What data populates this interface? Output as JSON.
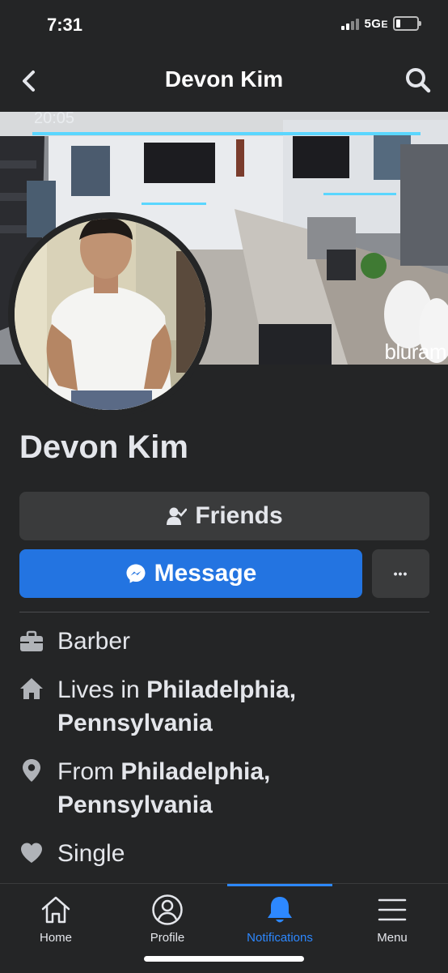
{
  "status_bar": {
    "time": "7:31",
    "network": "5G",
    "network_suffix": "E"
  },
  "header": {
    "title": "Devon Kim",
    "back_icon": "chevron-left-icon",
    "search_icon": "search-icon"
  },
  "cover": {
    "overlay_text": "20:05",
    "watermark": "bluram"
  },
  "profile": {
    "name": "Devon Kim",
    "friends_label": "Friends",
    "message_label": "Message",
    "more_label": "•••"
  },
  "info": {
    "work": "Barber",
    "lives_prefix": "Lives in ",
    "lives_place_line1": "Philadelphia,",
    "lives_place_line2": "Pennsylvania",
    "from_prefix": "From ",
    "from_place_line1": "Philadelphia,",
    "from_place_line2": "Pennsylvania",
    "relationship": "Single"
  },
  "nav": {
    "items": [
      {
        "label": "Home",
        "icon": "home-icon"
      },
      {
        "label": "Profile",
        "icon": "profile-icon"
      },
      {
        "label": "Notifications",
        "icon": "bell-icon",
        "active": true
      },
      {
        "label": "Menu",
        "icon": "menu-icon"
      }
    ]
  },
  "colors": {
    "accent": "#2374e1",
    "background": "#242526",
    "button": "#3a3b3c",
    "text": "#e4e6eb"
  }
}
